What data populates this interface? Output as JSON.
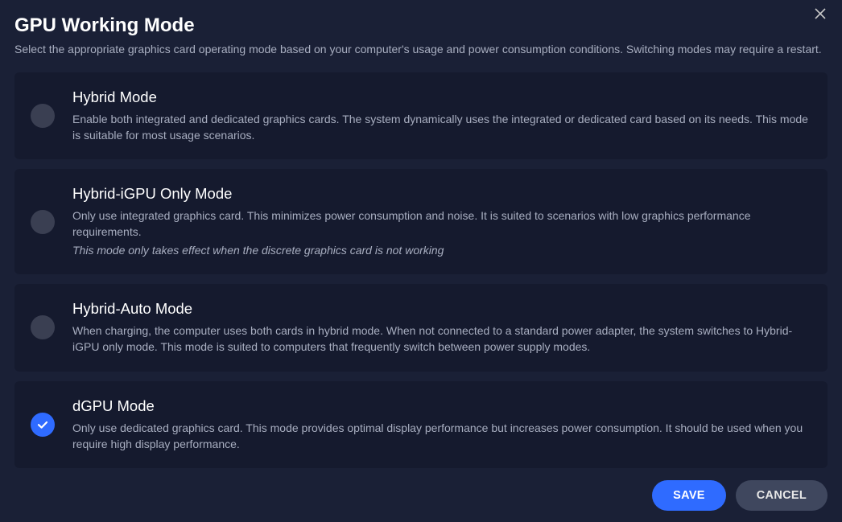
{
  "header": {
    "title": "GPU Working Mode",
    "subtitle": "Select the appropriate graphics card operating mode based on your computer's usage and power consumption conditions. Switching modes may require a restart."
  },
  "options": [
    {
      "id": "hybrid",
      "title": "Hybrid Mode",
      "desc": "Enable both integrated and dedicated graphics cards. The system dynamically uses the integrated or dedicated card based on its needs. This mode is suitable for most usage scenarios.",
      "note": "",
      "selected": false
    },
    {
      "id": "hybrid-igpu",
      "title": "Hybrid-iGPU Only Mode",
      "desc": "Only use integrated graphics card. This minimizes power consumption and noise. It is suited to scenarios with low graphics performance requirements.",
      "note": "This mode only takes effect when the discrete graphics card is not working",
      "selected": false
    },
    {
      "id": "hybrid-auto",
      "title": "Hybrid-Auto Mode",
      "desc": "When charging, the computer uses both cards in hybrid mode. When not connected to a standard power adapter, the system switches to Hybrid-iGPU only mode. This mode is suited to computers that frequently switch between power supply modes.",
      "note": "",
      "selected": false
    },
    {
      "id": "dgpu",
      "title": "dGPU Mode",
      "desc": "Only use dedicated graphics card. This mode provides optimal display performance but increases power consumption. It should be used when you require high display performance.",
      "note": "",
      "selected": true
    }
  ],
  "footer": {
    "save_label": "SAVE",
    "cancel_label": "CANCEL"
  }
}
